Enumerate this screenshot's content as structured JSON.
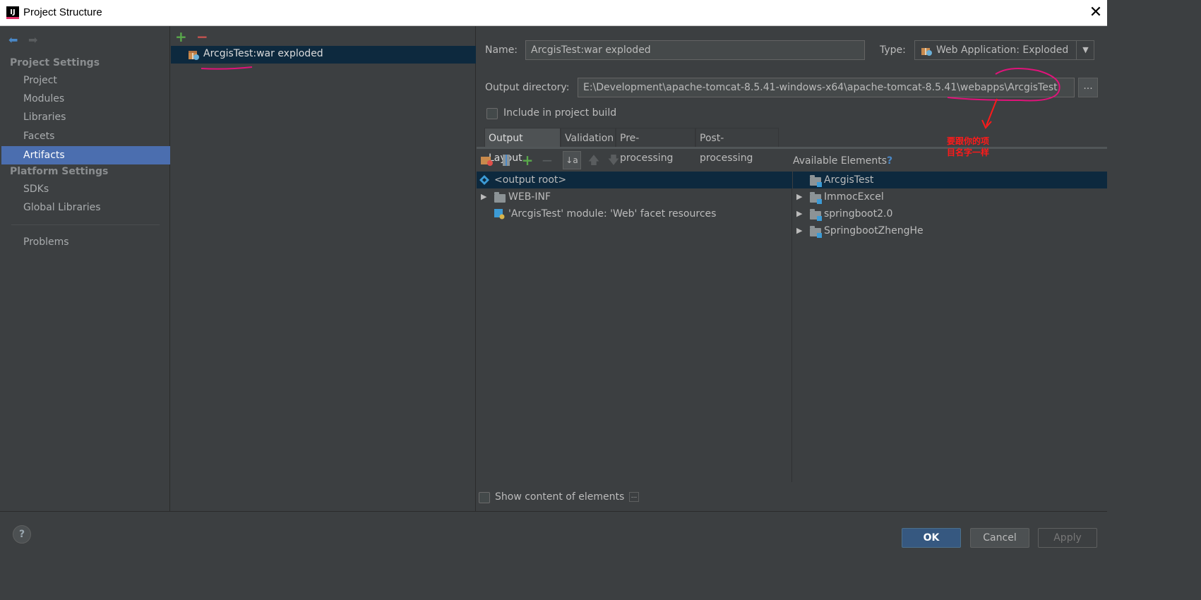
{
  "window": {
    "title": "Project Structure",
    "close_glyph": "✕"
  },
  "sidebar": {
    "back_glyph": "⬅",
    "forward_glyph": "➡",
    "project_settings_head": "Project Settings",
    "platform_settings_head": "Platform Settings",
    "items": [
      {
        "label": "Project"
      },
      {
        "label": "Modules"
      },
      {
        "label": "Libraries"
      },
      {
        "label": "Facets"
      },
      {
        "label": "Artifacts",
        "selected": true
      },
      {
        "label": "SDKs"
      },
      {
        "label": "Global Libraries"
      },
      {
        "label": "Problems"
      }
    ]
  },
  "artifacts": {
    "add_glyph": "+",
    "remove_glyph": "−",
    "list": [
      {
        "label": "ArcgisTest:war exploded",
        "icon": "war-artifact-icon"
      }
    ]
  },
  "details": {
    "name_label": "Name:",
    "name_value": "ArcgisTest:war exploded",
    "type_label": "Type:",
    "type_value": "Web Application: Exploded",
    "output_dir_label": "Output directory:",
    "output_dir_value": "E:\\Development\\apache-tomcat-8.5.41-windows-x64\\apache-tomcat-8.5.41\\webapps\\ArcgisTest",
    "browse_label": "...",
    "include_build_label": "Include in project build",
    "include_build_checked": false,
    "tabs": [
      {
        "label": "Output Layout",
        "selected": true
      },
      {
        "label": "Validation"
      },
      {
        "label": "Pre-processing"
      },
      {
        "label": "Post-processing"
      }
    ],
    "available_elements_label": "Available Elements",
    "available_help": "?",
    "output_tree": [
      {
        "label": "<output root>",
        "icon": "output-root-icon",
        "selected": true
      },
      {
        "label": "WEB-INF",
        "icon": "folder-icon",
        "expandable": true
      },
      {
        "label": "'ArcgisTest' module: 'Web' facet resources",
        "icon": "web-facet-icon"
      }
    ],
    "available_tree": [
      {
        "label": "ArcgisTest",
        "selected": true
      },
      {
        "label": "ImmocExcel",
        "expandable": true
      },
      {
        "label": "springboot2.0",
        "expandable": true
      },
      {
        "label": "SpringbootZhengHe",
        "expandable": true
      }
    ],
    "show_content_label": "Show content of elements",
    "show_content_more": "..."
  },
  "annotation": {
    "text_line1": "要跟你的项",
    "text_line2": "目名字一样",
    "color": "#ff1a1a"
  },
  "footer": {
    "help": "?",
    "ok": "OK",
    "cancel": "Cancel",
    "apply": "Apply"
  },
  "colors": {
    "selection": "#4b6eaf",
    "tree_selection": "#0d293e",
    "background": "#3c3f41",
    "ink": "#e0137a"
  }
}
